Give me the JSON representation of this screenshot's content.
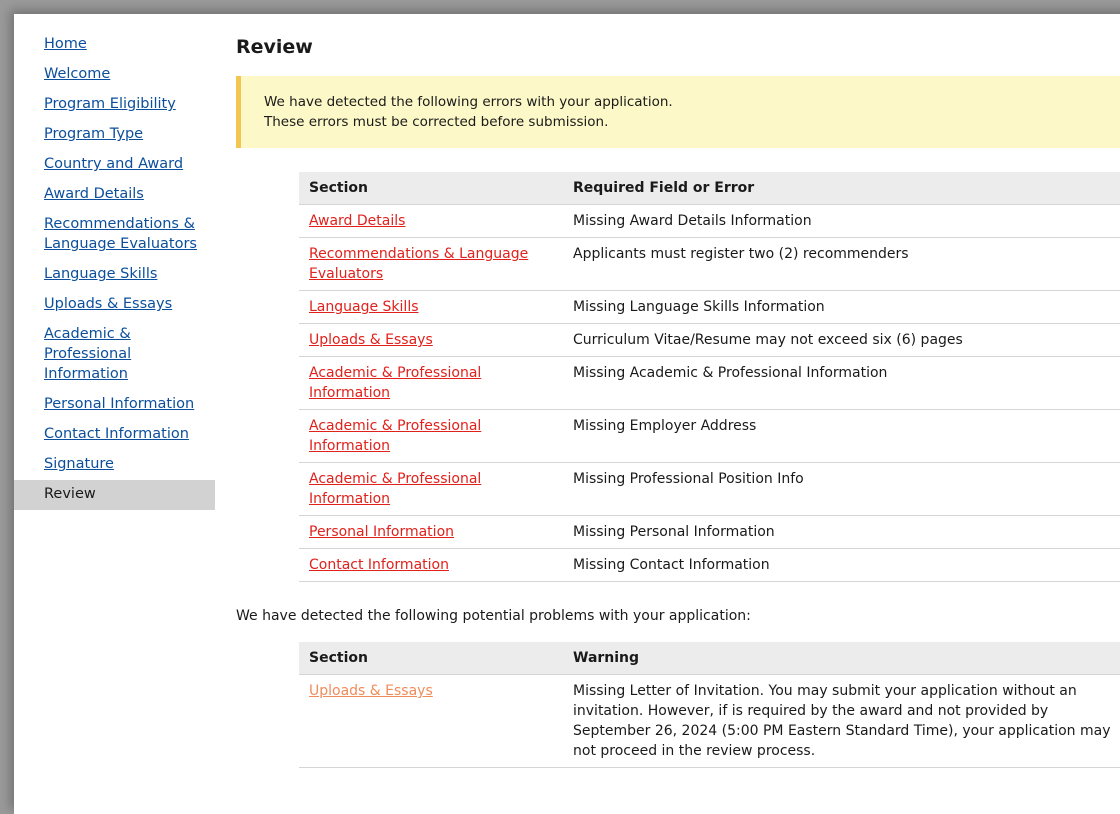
{
  "sidebar": {
    "items": [
      {
        "label": "Home",
        "active": false
      },
      {
        "label": "Welcome",
        "active": false
      },
      {
        "label": "Program Eligibility",
        "active": false
      },
      {
        "label": "Program Type",
        "active": false
      },
      {
        "label": "Country and Award",
        "active": false
      },
      {
        "label": "Award Details",
        "active": false
      },
      {
        "label": "Recommendations & Language Evaluators",
        "active": false
      },
      {
        "label": "Language Skills",
        "active": false
      },
      {
        "label": "Uploads & Essays",
        "active": false
      },
      {
        "label": "Academic & Professional Information",
        "active": false
      },
      {
        "label": "Personal Information",
        "active": false
      },
      {
        "label": "Contact Information",
        "active": false
      },
      {
        "label": "Signature",
        "active": false
      },
      {
        "label": "Review",
        "active": true
      }
    ]
  },
  "main": {
    "title": "Review",
    "alert": {
      "line1": "We have detected the following errors with your application.",
      "line2": "These errors must be corrected before submission."
    },
    "errors": {
      "headers": {
        "section": "Section",
        "detail": "Required Field or Error"
      },
      "rows": [
        {
          "section": "Award Details",
          "detail": "Missing Award Details Information"
        },
        {
          "section": "Recommendations & Language Evaluators",
          "detail": "Applicants must register two (2) recommenders"
        },
        {
          "section": "Language Skills",
          "detail": "Missing Language Skills Information"
        },
        {
          "section": "Uploads & Essays",
          "detail": "Curriculum Vitae/Resume may not exceed six (6) pages"
        },
        {
          "section": "Academic & Professional Information",
          "detail": "Missing Academic & Professional Information"
        },
        {
          "section": "Academic & Professional Information",
          "detail": "Missing Employer Address"
        },
        {
          "section": "Academic & Professional Information",
          "detail": "Missing Professional Position Info"
        },
        {
          "section": "Personal Information",
          "detail": "Missing Personal Information"
        },
        {
          "section": "Contact Information",
          "detail": "Missing Contact Information"
        }
      ]
    },
    "warnings_intro": "We have detected the following potential problems with your application:",
    "warnings": {
      "headers": {
        "section": "Section",
        "detail": "Warning"
      },
      "rows": [
        {
          "section": "Uploads & Essays",
          "detail": "Missing Letter of Invitation. You may submit your application without an invitation. However, if is required by the award and not provided by September 26, 2024 (5:00 PM Eastern Standard Time), your application may not proceed in the review process."
        }
      ]
    }
  },
  "colors": {
    "link": "#0b4f9c",
    "error_link": "#e0211c",
    "warning_link": "#ef8c5a",
    "alert_bg": "#fcf8c8",
    "alert_border": "#f3c552",
    "active_nav_bg": "#d2d2d2"
  }
}
